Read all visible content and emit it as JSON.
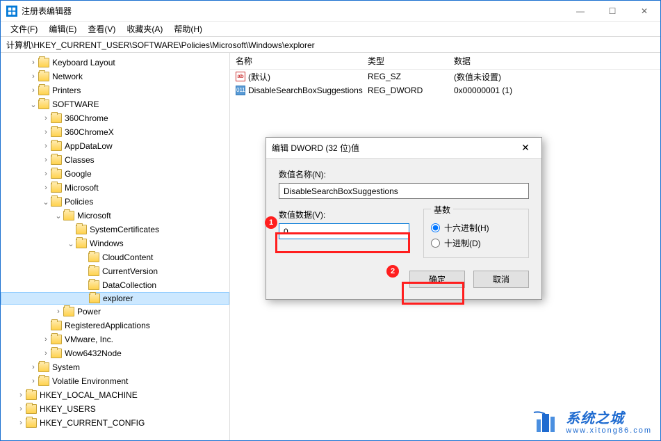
{
  "window": {
    "title": "注册表编辑器",
    "minimize_label": "—",
    "maximize_label": "☐",
    "close_label": "✕"
  },
  "menu": {
    "file": "文件(F)",
    "edit": "编辑(E)",
    "view": "查看(V)",
    "favorites": "收藏夹(A)",
    "help": "帮助(H)"
  },
  "addressbar": {
    "path": "计算机\\HKEY_CURRENT_USER\\SOFTWARE\\Policies\\Microsoft\\Windows\\explorer"
  },
  "tree": {
    "root": "计算机",
    "hkcu_children_top": [
      "Keyboard Layout",
      "Network",
      "Printers"
    ],
    "software": {
      "label": "SOFTWARE",
      "children": [
        "360Chrome",
        "360ChromeX",
        "AppDataLow",
        "Classes",
        "Google",
        "Microsoft"
      ],
      "policies": {
        "label": "Policies",
        "microsoft": {
          "label": "Microsoft",
          "children_top": [
            "SystemCertificates"
          ],
          "windows": {
            "label": "Windows",
            "children": [
              "CloudContent",
              "CurrentVersion",
              "DataCollection",
              "explorer"
            ],
            "selected": "explorer"
          }
        },
        "children_after": [
          "Power"
        ]
      },
      "children_after": [
        "RegisteredApplications",
        "VMware, Inc.",
        "Wow6432Node"
      ]
    },
    "hkcu_children_bottom": [
      "System",
      "Volatile Environment"
    ],
    "hives_after": [
      "HKEY_LOCAL_MACHINE",
      "HKEY_USERS",
      "HKEY_CURRENT_CONFIG"
    ]
  },
  "list": {
    "headers": {
      "name": "名称",
      "type": "类型",
      "data": "数据"
    },
    "rows": [
      {
        "icon": "str",
        "name": "(默认)",
        "type": "REG_SZ",
        "data": "(数值未设置)"
      },
      {
        "icon": "bin",
        "name": "DisableSearchBoxSuggestions",
        "type": "REG_DWORD",
        "data": "0x00000001 (1)"
      }
    ]
  },
  "dialog": {
    "title": "编辑 DWORD (32 位)值",
    "name_label": "数值名称(N):",
    "name_value": "DisableSearchBoxSuggestions",
    "data_label": "数值数据(V):",
    "data_value": "0",
    "base_label": "基数",
    "radio_hex": "十六进制(H)",
    "radio_dec": "十进制(D)",
    "ok": "确定",
    "cancel": "取消",
    "close": "✕"
  },
  "annotations": {
    "badge1": "1",
    "badge2": "2"
  },
  "watermark": {
    "line1": "系统之城",
    "line2": "www.xitong86.com"
  }
}
